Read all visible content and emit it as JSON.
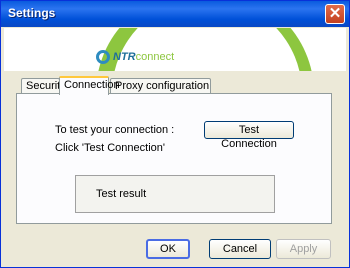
{
  "window": {
    "title": "Settings"
  },
  "brand": {
    "logo_ntr": "NTR",
    "logo_connect": "connect"
  },
  "tabs": [
    {
      "label": "Security"
    },
    {
      "label": "Connection"
    },
    {
      "label": "Proxy configuration"
    }
  ],
  "connection": {
    "test_prompt": "To test your connection :",
    "test_instruction": "Click 'Test Connection'",
    "test_button": "Test Connection",
    "result_label": "Test result"
  },
  "footer": {
    "ok": "OK",
    "cancel": "Cancel",
    "apply": "Apply"
  }
}
